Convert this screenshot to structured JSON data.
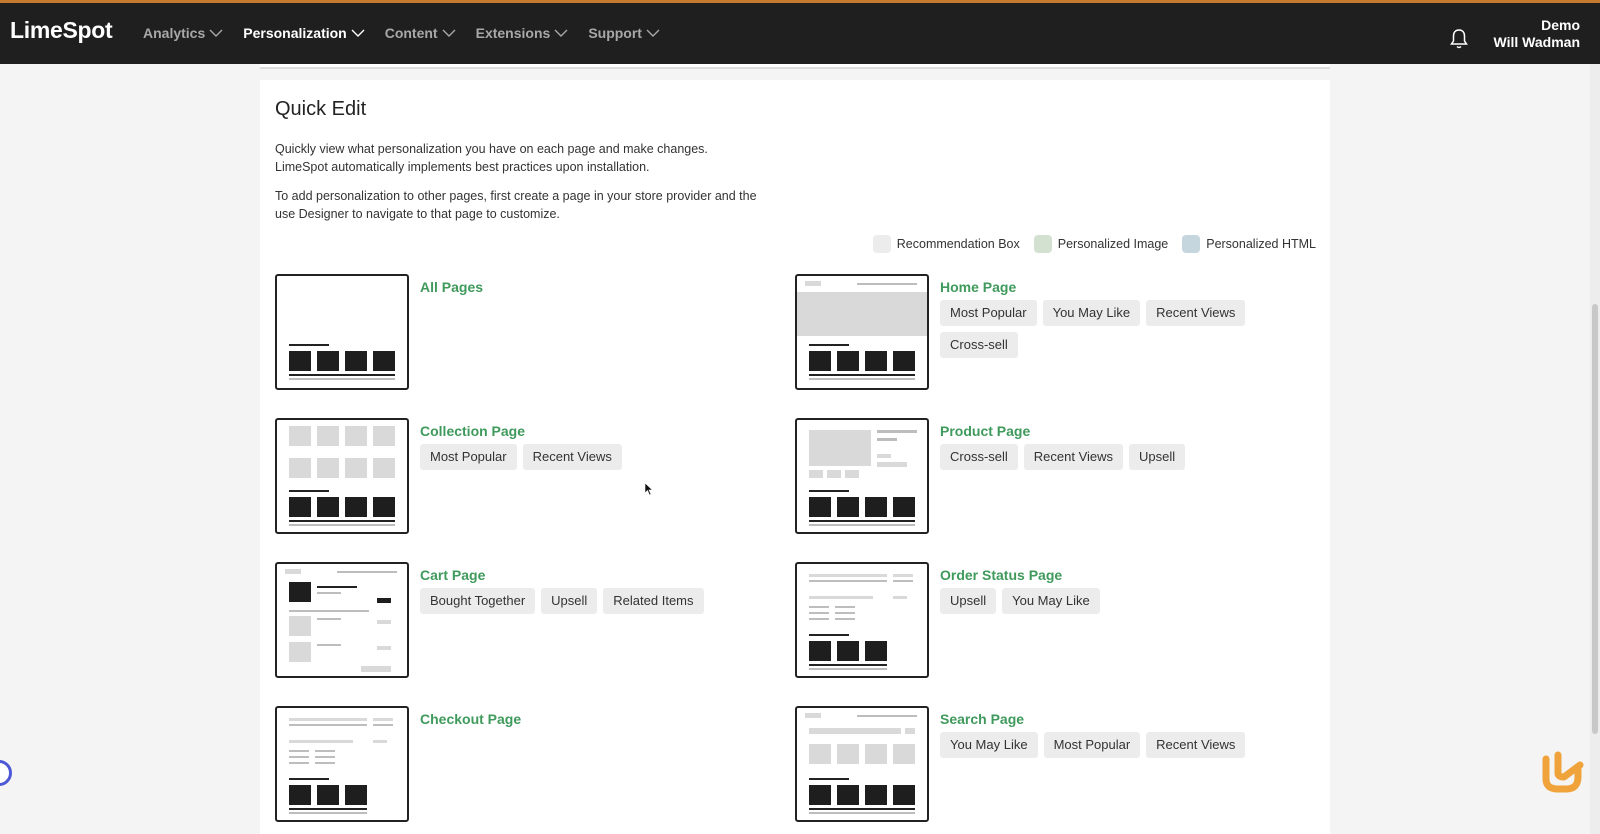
{
  "nav": {
    "logo": "LimeSpot",
    "items": [
      {
        "label": "Analytics",
        "active": false
      },
      {
        "label": "Personalization",
        "active": true
      },
      {
        "label": "Content",
        "active": false
      },
      {
        "label": "Extensions",
        "active": false
      },
      {
        "label": "Support",
        "active": false
      }
    ],
    "user_line1": "Demo",
    "user_line2": "Will Wadman",
    "bell_icon": "bell-icon"
  },
  "quick_edit": {
    "title": "Quick Edit",
    "desc1_line1": "Quickly view what personalization you have on each page and make changes.",
    "desc1_line2": "LimeSpot automatically implements best practices upon installation.",
    "desc2_line1": "To add personalization to other pages, first create a page in your store provider and the",
    "desc2_line2": "use Designer to navigate to that page to customize.",
    "legend": [
      {
        "label": "Recommendation Box",
        "color": "#ececec"
      },
      {
        "label": "Personalized Image",
        "color": "#d3e1d0"
      },
      {
        "label": "Personalized HTML",
        "color": "#c6d6df"
      }
    ]
  },
  "pages": [
    {
      "name": "All Pages",
      "chips": []
    },
    {
      "name": "Home Page",
      "chips": [
        "Most Popular",
        "You May Like",
        "Recent Views",
        "Cross-sell"
      ]
    },
    {
      "name": "Collection Page",
      "chips": [
        "Most Popular",
        "Recent Views"
      ]
    },
    {
      "name": "Product Page",
      "chips": [
        "Cross-sell",
        "Recent Views",
        "Upsell"
      ]
    },
    {
      "name": "Cart Page",
      "chips": [
        "Bought Together",
        "Upsell",
        "Related Items"
      ]
    },
    {
      "name": "Order Status Page",
      "chips": [
        "Upsell",
        "You May Like"
      ]
    },
    {
      "name": "Checkout Page",
      "chips": []
    },
    {
      "name": "Search Page",
      "chips": [
        "You May Like",
        "Most Popular",
        "Recent Views"
      ]
    }
  ],
  "colors": {
    "accent": "#3f9a5c",
    "nav_bg": "#1f1f1f",
    "brand_orange": "#f0a33a"
  }
}
